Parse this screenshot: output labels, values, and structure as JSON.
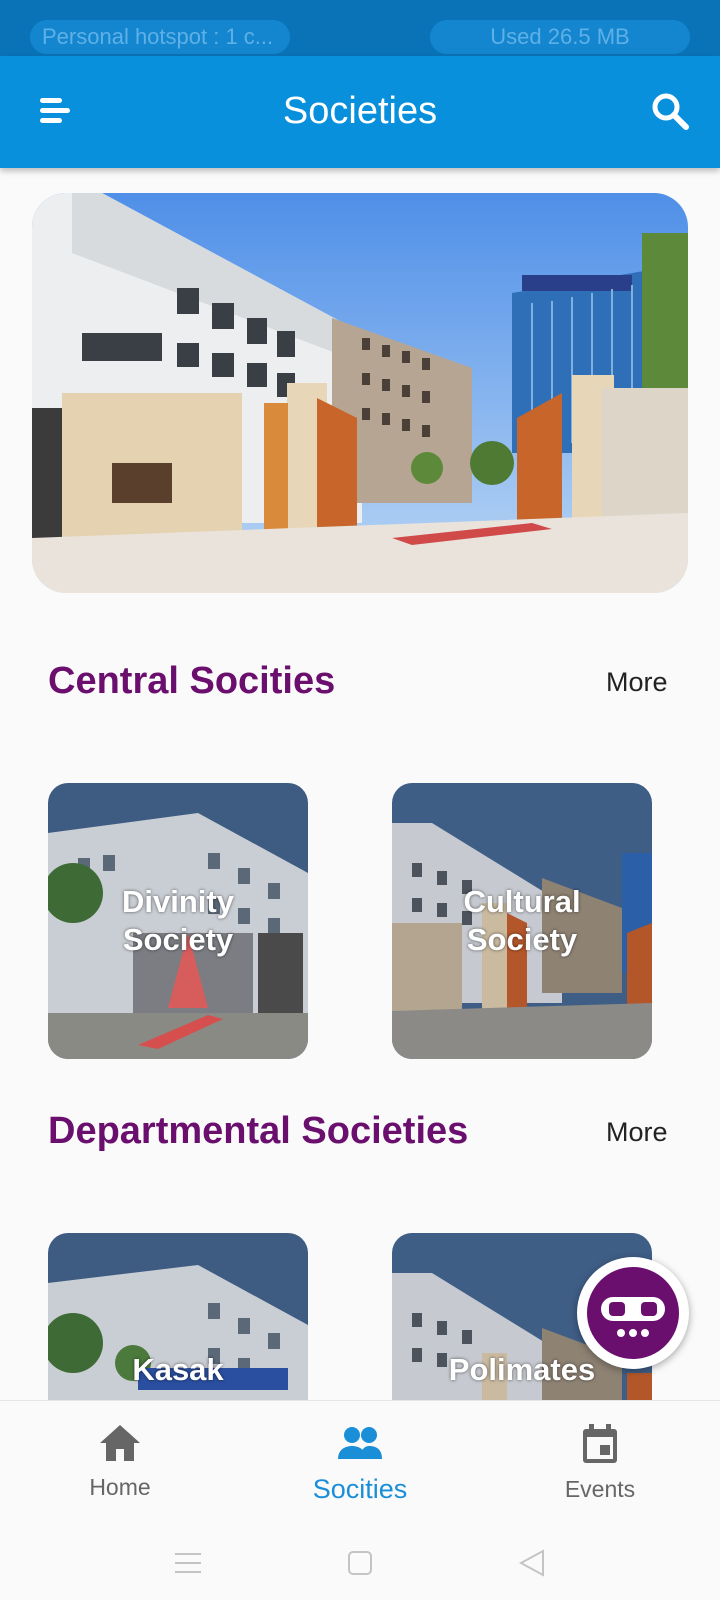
{
  "status_bar": {
    "hotspot_text": "Personal hotspot : 1 c...",
    "data_used_text": "Used  26.5 MB"
  },
  "app_bar": {
    "title": "Societies",
    "menu_icon": "menu-icon",
    "search_icon": "search-icon"
  },
  "hero": {
    "image": "college-campus-gate-photo"
  },
  "central": {
    "title": "Central Socities",
    "more_label": "More",
    "cards": [
      {
        "label_line1": "Divinity",
        "label_line2": "Society"
      },
      {
        "label_line1": "Cultural",
        "label_line2": "Society"
      }
    ]
  },
  "departmental": {
    "title": "Departmental Societies",
    "more_label": "More",
    "cards": [
      {
        "label": "Kasak"
      },
      {
        "label": "Polimates"
      }
    ]
  },
  "bottom_nav": {
    "items": [
      {
        "label": "Home",
        "icon": "home-icon",
        "active": false
      },
      {
        "label": "Socities",
        "icon": "people-icon",
        "active": true
      },
      {
        "label": "Events",
        "icon": "calendar-icon",
        "active": false
      }
    ]
  },
  "colors": {
    "app_bar": "#0890dc",
    "status_bar": "#0a73b8",
    "section_title": "#6a0f6e",
    "active_nav": "#1a8fd8",
    "bot_button": "#6a0f6e"
  }
}
